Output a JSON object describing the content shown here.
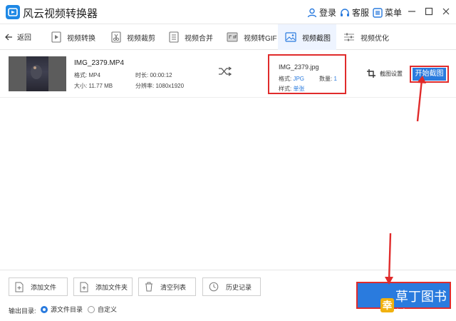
{
  "app": {
    "title": "风云视频转换器"
  },
  "titlebar": {
    "login": "登录",
    "support": "客服",
    "menu": "菜单"
  },
  "toolbar": {
    "back": "返回",
    "tabs": [
      {
        "label": "视频转换",
        "icon": "play-icon"
      },
      {
        "label": "视频裁剪",
        "icon": "scissors-icon"
      },
      {
        "label": "视频合并",
        "icon": "merge-icon"
      },
      {
        "label": "视频转GIF",
        "icon": "gif-icon"
      },
      {
        "label": "视频截图",
        "icon": "image-icon",
        "active": true
      },
      {
        "label": "视频优化",
        "icon": "sliders-icon"
      }
    ]
  },
  "file": {
    "name": "IMG_2379.MP4",
    "format_label": "格式:",
    "format_value": "MP4",
    "duration_label": "时长:",
    "duration_value": "00:00:12",
    "size_label": "大小:",
    "size_value": "11.77 MB",
    "resolution_label": "分辨率:",
    "resolution_value": "1080x1920"
  },
  "output": {
    "name": "IMG_2379.jpg",
    "format_label": "格式:",
    "format_value": "JPG",
    "count_label": "数量:",
    "count_value": "1",
    "style_label": "样式:",
    "style_value": "单张"
  },
  "actions": {
    "crop_settings": "截图设置",
    "start_capture": "开始截图"
  },
  "bottom": {
    "buttons": [
      "添加文件",
      "添加文件夹",
      "清空列表",
      "历史记录"
    ],
    "output_dir_label": "输出目录:",
    "radio_source": "源文件目录",
    "radio_custom": "自定义",
    "selected": "源文件目录"
  },
  "watermark": {
    "seal": "幸",
    "text": "草丁图书馆"
  },
  "colors": {
    "accent": "#2a7bde",
    "highlight": "#e02b2b",
    "active_tab_bg": "#eef4ff"
  }
}
